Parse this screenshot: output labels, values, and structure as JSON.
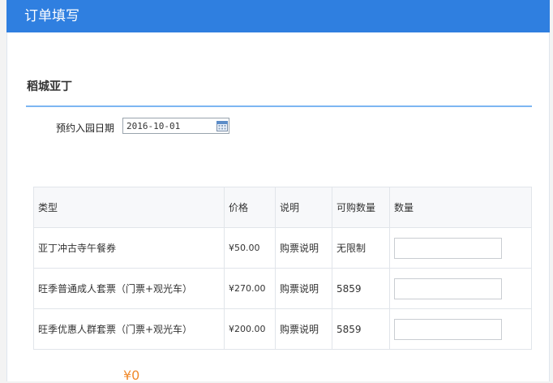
{
  "header": {
    "title": "订单填写"
  },
  "park": {
    "name": "稻城亚丁"
  },
  "booking": {
    "date_label": "预约入园日期",
    "date_value": "2016-10-01",
    "date_icon": "calendar-icon"
  },
  "table": {
    "headers": [
      "类型",
      "价格",
      "说明",
      "可购数量",
      "数量"
    ],
    "rows": [
      {
        "type": "亚丁冲古寺午餐券",
        "price": "¥50.00",
        "desc": "购票说明",
        "available": "无限制",
        "quantity": ""
      },
      {
        "type": "旺季普通成人套票（门票+观光车）",
        "price": "¥270.00",
        "desc": "购票说明",
        "available": "5859",
        "quantity": ""
      },
      {
        "type": "旺季优惠人群套票（门票+观光车）",
        "price": "¥200.00",
        "desc": "购票说明",
        "available": "5859",
        "quantity": ""
      }
    ]
  },
  "total": {
    "text": "¥0"
  },
  "colors": {
    "header_bg": "#2f7fe0",
    "accent_line": "#7db6f2",
    "total": "#f08a2c"
  }
}
